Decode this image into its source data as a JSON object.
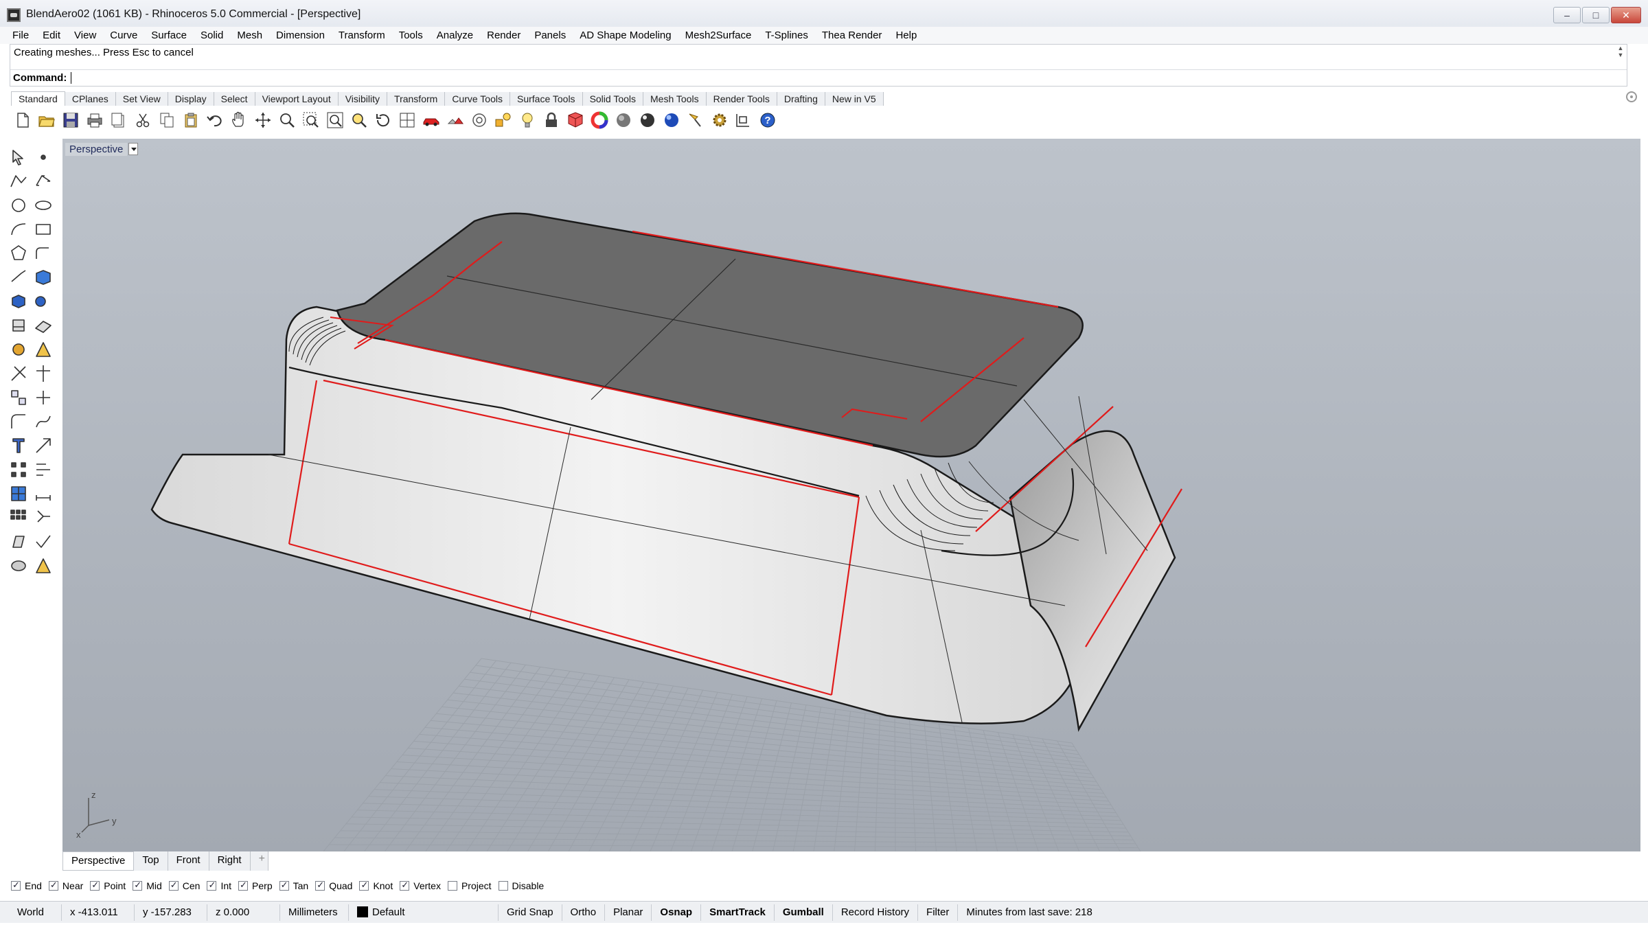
{
  "window": {
    "title": "BlendAero02 (1061 KB) - Rhinoceros 5.0 Commercial - [Perspective]",
    "min_label": "–",
    "max_label": "□",
    "close_label": "✕"
  },
  "menu": [
    "File",
    "Edit",
    "View",
    "Curve",
    "Surface",
    "Solid",
    "Mesh",
    "Dimension",
    "Transform",
    "Tools",
    "Analyze",
    "Render",
    "Panels",
    "AD Shape Modeling",
    "Mesh2Surface",
    "T-Splines",
    "Thea Render",
    "Help"
  ],
  "command": {
    "history": "Creating meshes... Press Esc to cancel",
    "label": "Command:",
    "value": ""
  },
  "toolbar_tabs": [
    "Standard",
    "CPlanes",
    "Set View",
    "Display",
    "Select",
    "Viewport Layout",
    "Visibility",
    "Transform",
    "Curve Tools",
    "Surface Tools",
    "Solid Tools",
    "Mesh Tools",
    "Render Tools",
    "Drafting",
    "New in V5"
  ],
  "toolbar_icons": [
    "new-file-icon",
    "open-file-icon",
    "save-icon",
    "print-icon",
    "import-icon",
    "cut-icon",
    "copy-icon",
    "paste-icon",
    "undo-icon",
    "pan-hand-icon",
    "move-view-icon",
    "zoom-in-icon",
    "zoom-window-icon",
    "zoom-extents-icon",
    "zoom-selected-icon",
    "rotate-view-icon",
    "four-viewports-icon",
    "car-icon",
    "options-icon",
    "target-icon",
    "points-icon",
    "light-icon",
    "lock-icon",
    "object-properties-icon",
    "color-wheel-icon",
    "shaded-sphere-icon",
    "rendered-sphere-icon",
    "render-sphere-blue-icon",
    "lamp-icon",
    "gear-settings-icon",
    "dimension-icon",
    "help-icon"
  ],
  "left_icons": [
    "select-arrow-icon",
    "point-icon",
    "polyline-icon",
    "control-points-icon",
    "circle-icon",
    "ellipse-icon",
    "arc-icon",
    "rectangle-icon",
    "polygon-icon",
    "curve-fillet-icon",
    "extend-icon",
    "surface-network-icon",
    "box-solid-icon",
    "boolean-union-icon",
    "extrude-solid-icon",
    "plane-surface-icon",
    "gear-solid-icon",
    "explode-icon",
    "trim-icon",
    "split-icon",
    "group-icon",
    "join-icon",
    "fillet-edge-icon",
    "blend-icon",
    "text-icon",
    "scale-icon",
    "array-icon",
    "align-icon",
    "mesh-icon",
    "dimension-tool-icon",
    "grid-array-icon",
    "orient-icon",
    "analyze-icon",
    "check-icon",
    "render-tool-icon",
    "light-tool-icon"
  ],
  "viewport": {
    "label": "Perspective",
    "axis_labels": {
      "x": "x",
      "y": "y",
      "z": "z"
    }
  },
  "view_tabs": [
    "Perspective",
    "Top",
    "Front",
    "Right"
  ],
  "add_tab_label": "+",
  "osnaps": [
    {
      "label": "End",
      "checked": true
    },
    {
      "label": "Near",
      "checked": true
    },
    {
      "label": "Point",
      "checked": true
    },
    {
      "label": "Mid",
      "checked": true
    },
    {
      "label": "Cen",
      "checked": true
    },
    {
      "label": "Int",
      "checked": true
    },
    {
      "label": "Perp",
      "checked": true
    },
    {
      "label": "Tan",
      "checked": true
    },
    {
      "label": "Quad",
      "checked": true
    },
    {
      "label": "Knot",
      "checked": true
    },
    {
      "label": "Vertex",
      "checked": true
    },
    {
      "label": "Project",
      "checked": false
    },
    {
      "label": "Disable",
      "checked": false
    }
  ],
  "status": {
    "cplane": "World",
    "x": "x -413.011",
    "y": "y -157.283",
    "z": "z 0.000",
    "units": "Millimeters",
    "layer": "Default",
    "grid_snap": "Grid Snap",
    "ortho": "Ortho",
    "planar": "Planar",
    "osnap": "Osnap",
    "smarttrack": "SmartTrack",
    "gumball": "Gumball",
    "record_history": "Record History",
    "filter": "Filter",
    "save_info": "Minutes from last save: 218"
  },
  "colors": {
    "viewport_bg_top": "#bdc3cb",
    "viewport_bg_bottom": "#a3a9b2",
    "top_face": "#6a6a6a",
    "side_face": "#ebebeb",
    "seam_red": "#e01b1b",
    "edge_black": "#1a1a1a"
  }
}
